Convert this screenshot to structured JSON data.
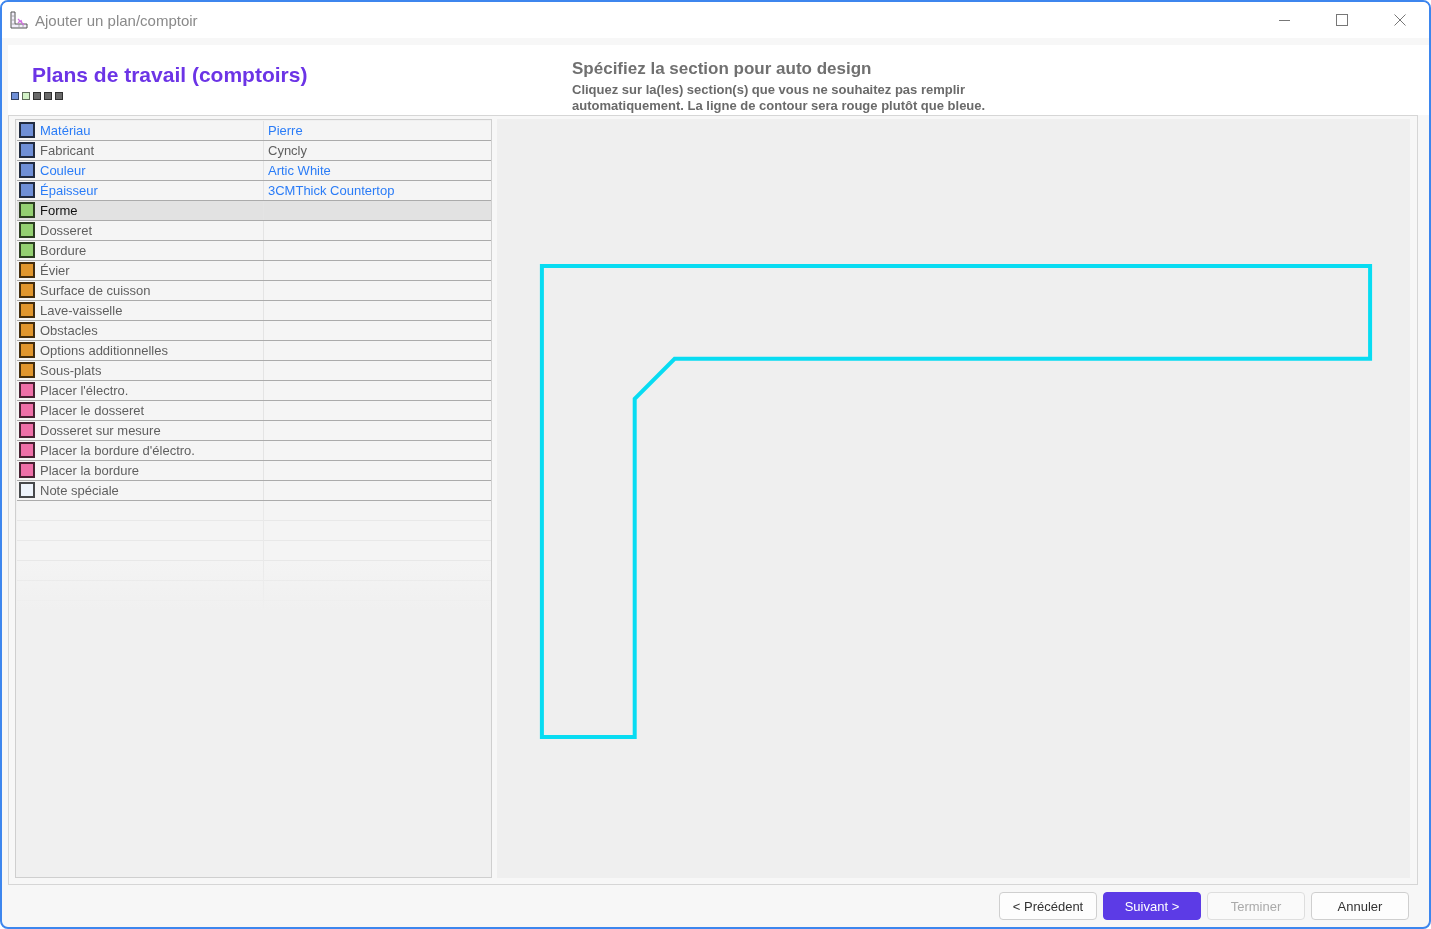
{
  "window": {
    "title": "Ajouter un plan/comptoir"
  },
  "header": {
    "title": "Plans de travail (comptoirs)",
    "steps": [
      {
        "color": "#6f8fd6"
      },
      {
        "color": "#d4f3c8"
      },
      {
        "color": "#6a6a6a"
      },
      {
        "color": "#6a6a6a"
      },
      {
        "color": "#6a6a6a"
      }
    ],
    "heading": "Spécifiez la section pour auto design",
    "instructions": "Cliquez sur la(les) section(s) que vous ne souhaitez pas remplir automatiquement. La ligne de contour sera rouge plutôt que bleue."
  },
  "properties": [
    {
      "label": "Matériau",
      "value": "Pierre",
      "color": "#6f8fd6",
      "link": true,
      "selected": false
    },
    {
      "label": "Fabricant",
      "value": "Cyncly",
      "color": "#6f8fd6",
      "link": false,
      "selected": false
    },
    {
      "label": "Couleur",
      "value": "Artic White",
      "color": "#6f8fd6",
      "link": true,
      "selected": false
    },
    {
      "label": "Épaisseur",
      "value": "3CMThick Countertop",
      "color": "#6f8fd6",
      "link": true,
      "selected": false
    },
    {
      "label": "Forme",
      "color": "#94d072",
      "link": false,
      "selected": true
    },
    {
      "label": "Dosseret",
      "color": "#94d072",
      "link": false,
      "selected": false
    },
    {
      "label": "Bordure",
      "color": "#94d072",
      "link": false,
      "selected": false
    },
    {
      "label": "Évier",
      "color": "#e0962e",
      "link": false,
      "selected": false
    },
    {
      "label": "Surface de cuisson",
      "color": "#e0962e",
      "link": false,
      "selected": false
    },
    {
      "label": "Lave-vaisselle",
      "color": "#e0962e",
      "link": false,
      "selected": false
    },
    {
      "label": "Obstacles",
      "color": "#e0962e",
      "link": false,
      "selected": false
    },
    {
      "label": "Options additionnelles",
      "color": "#e0962e",
      "link": false,
      "selected": false
    },
    {
      "label": "Sous-plats",
      "color": "#e0962e",
      "link": false,
      "selected": false
    },
    {
      "label": "Placer l'électro.",
      "color": "#ee6fa8",
      "link": false,
      "selected": false
    },
    {
      "label": "Placer le dosseret",
      "color": "#ee6fa8",
      "link": false,
      "selected": false
    },
    {
      "label": "Dosseret sur mesure",
      "color": "#ee6fa8",
      "link": false,
      "selected": false
    },
    {
      "label": "Placer la bordure d'électro.",
      "color": "#ee6fa8",
      "link": false,
      "selected": false
    },
    {
      "label": "Placer la bordure",
      "color": "#ee6fa8",
      "link": false,
      "selected": false
    },
    {
      "label": "Note spéciale",
      "color": "#eef4fb",
      "link": false,
      "selected": false
    }
  ],
  "buttons": [
    {
      "label": "< Précédent",
      "kind": "default",
      "disabled": false
    },
    {
      "label": "Suivant >",
      "kind": "primary",
      "disabled": false
    },
    {
      "label": "Terminer",
      "kind": "default",
      "disabled": true
    },
    {
      "label": "Annuler",
      "kind": "default",
      "disabled": false
    }
  ]
}
